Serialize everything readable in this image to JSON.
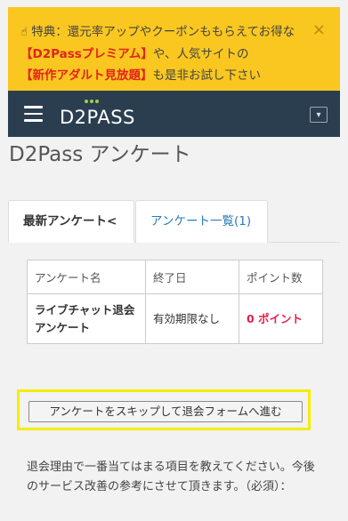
{
  "banner": {
    "hand_icon": "☝",
    "text_1": "特典：還元率アップやクーポンももらえてお得な",
    "premium": "【D2Passプレミアム】",
    "text_2": "や、人気サイトの",
    "adult": "【新作アダルト見放題】",
    "text_3": "も是非お試し下さい",
    "close": "×"
  },
  "navbar": {
    "logo": "D2PASS",
    "dropdown_icon": "▾"
  },
  "page": {
    "title": "D2Pass アンケート"
  },
  "tabs": [
    {
      "label": "最新アンケート<"
    },
    {
      "label": "アンケート一覧(1)"
    }
  ],
  "table": {
    "headers": [
      "アンケート名",
      "終了日",
      "ポイント数"
    ],
    "rows": [
      {
        "name": "ライブチャット退会アンケート",
        "end_date": "有効期限なし",
        "points": "0 ポイント"
      }
    ]
  },
  "skip_button": "アンケートをスキップして退会フォームへ進む",
  "reason_text": "退会理由で一番当てはまる項目を教えてください。今後のサービス改善の参考にさせて頂きます。（必須）：",
  "colors": {
    "banner_bg": "#f9c71f",
    "navbar_bg": "#2b3e50",
    "highlight_red": "#e2231a",
    "link_blue": "#2c7bb8",
    "points_pink": "#e2234c",
    "skip_outline": "#f5ec00"
  }
}
